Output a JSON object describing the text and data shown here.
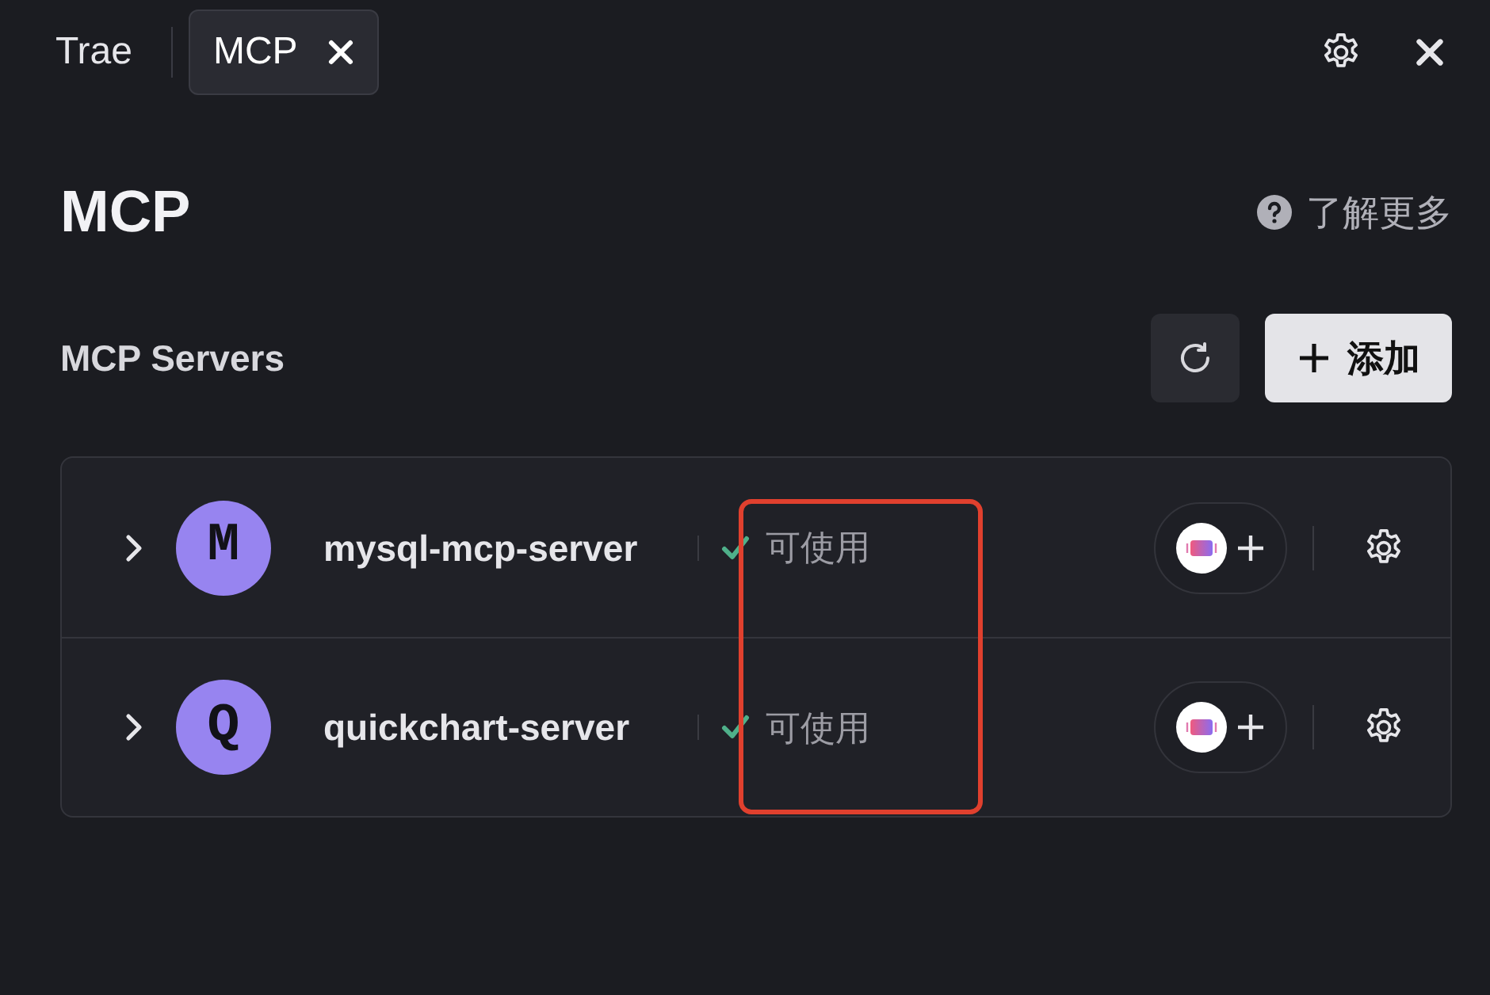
{
  "tabs": [
    {
      "label": "Trae",
      "selected": false,
      "closable": false
    },
    {
      "label": "MCP",
      "selected": true,
      "closable": true
    }
  ],
  "heading": "MCP",
  "help_link": "了解更多",
  "section_title": "MCP Servers",
  "add_button": "添加",
  "servers": [
    {
      "initial": "M",
      "name": "mysql-mcp-server",
      "status": "可使用",
      "available": true
    },
    {
      "initial": "Q",
      "name": "quickchart-server",
      "status": "可使用",
      "available": true
    }
  ],
  "highlight_status": true
}
